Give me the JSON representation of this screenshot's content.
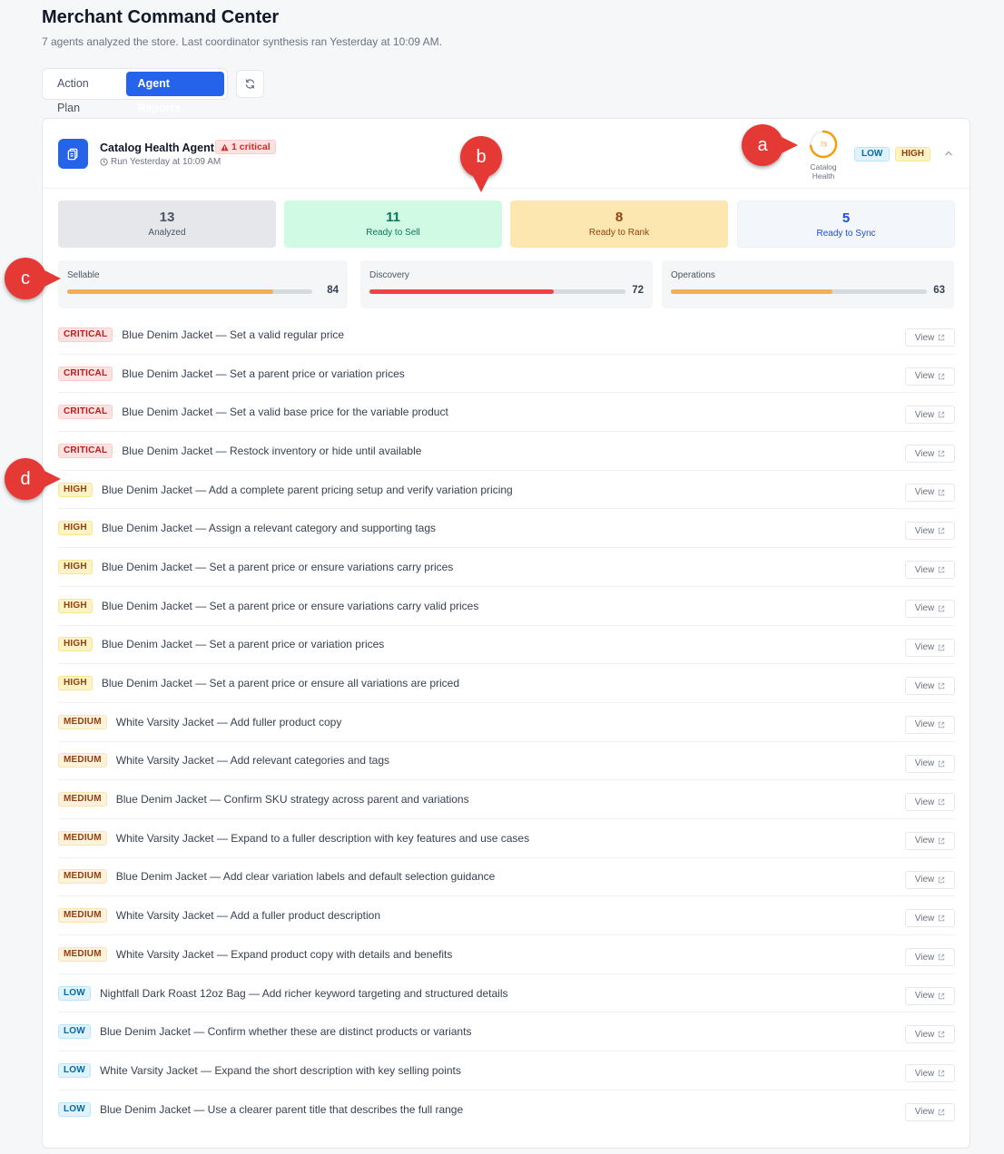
{
  "header": {
    "title": "Merchant Command Center",
    "subtitle": "7 agents analyzed the store. Last coordinator synthesis ran Yesterday at 10:09 AM."
  },
  "tabs": [
    {
      "label": "Action Plan",
      "active": false
    },
    {
      "label": "Agent Reports",
      "active": true
    }
  ],
  "agent": {
    "name": "Catalog Health Agent",
    "critical_badge": "1 critical",
    "run_info": "Run Yesterday at 10:09 AM",
    "health_score": 73,
    "health_label": "Catalog Health",
    "chips": [
      "LOW",
      "HIGH"
    ]
  },
  "stats": [
    {
      "value": "13",
      "label": "Analyzed"
    },
    {
      "value": "11",
      "label": "Ready to Sell"
    },
    {
      "value": "8",
      "label": "Ready to Rank"
    },
    {
      "value": "5",
      "label": "Ready to Sync"
    }
  ],
  "meters": [
    {
      "label": "Sellable",
      "value": 84,
      "color": "#f6ad55"
    },
    {
      "label": "Discovery",
      "value": 72,
      "color": "#ef4444"
    },
    {
      "label": "Operations",
      "value": 63,
      "color": "#f6ad55"
    }
  ],
  "view_label": "View",
  "recommendations": [
    {
      "severity": "CRITICAL",
      "text": "Blue Denim Jacket — Set a valid regular price"
    },
    {
      "severity": "CRITICAL",
      "text": "Blue Denim Jacket — Set a parent price or variation prices"
    },
    {
      "severity": "CRITICAL",
      "text": "Blue Denim Jacket — Set a valid base price for the variable product"
    },
    {
      "severity": "CRITICAL",
      "text": "Blue Denim Jacket — Restock inventory or hide until available"
    },
    {
      "severity": "HIGH",
      "text": "Blue Denim Jacket — Add a complete parent pricing setup and verify variation pricing"
    },
    {
      "severity": "HIGH",
      "text": "Blue Denim Jacket — Assign a relevant category and supporting tags"
    },
    {
      "severity": "HIGH",
      "text": "Blue Denim Jacket — Set a parent price or ensure variations carry prices"
    },
    {
      "severity": "HIGH",
      "text": "Blue Denim Jacket — Set a parent price or ensure variations carry valid prices"
    },
    {
      "severity": "HIGH",
      "text": "Blue Denim Jacket — Set a parent price or variation prices"
    },
    {
      "severity": "HIGH",
      "text": "Blue Denim Jacket — Set a parent price or ensure all variations are priced"
    },
    {
      "severity": "MEDIUM",
      "text": "White Varsity Jacket — Add fuller product copy"
    },
    {
      "severity": "MEDIUM",
      "text": "White Varsity Jacket — Add relevant categories and tags"
    },
    {
      "severity": "MEDIUM",
      "text": "Blue Denim Jacket — Confirm SKU strategy across parent and variations"
    },
    {
      "severity": "MEDIUM",
      "text": "White Varsity Jacket — Expand to a fuller description with key features and use cases"
    },
    {
      "severity": "MEDIUM",
      "text": "Blue Denim Jacket — Add clear variation labels and default selection guidance"
    },
    {
      "severity": "MEDIUM",
      "text": "White Varsity Jacket — Add a fuller product description"
    },
    {
      "severity": "MEDIUM",
      "text": "White Varsity Jacket — Expand product copy with details and benefits"
    },
    {
      "severity": "LOW",
      "text": "Nightfall Dark Roast 12oz Bag — Add richer keyword targeting and structured details"
    },
    {
      "severity": "LOW",
      "text": "Blue Denim Jacket — Confirm whether these are distinct products or variants"
    },
    {
      "severity": "LOW",
      "text": "White Varsity Jacket — Expand the short description with key selling points"
    },
    {
      "severity": "LOW",
      "text": "Blue Denim Jacket — Use a clearer parent title that describes the full range"
    }
  ],
  "markers": [
    "a",
    "b",
    "c",
    "d"
  ]
}
